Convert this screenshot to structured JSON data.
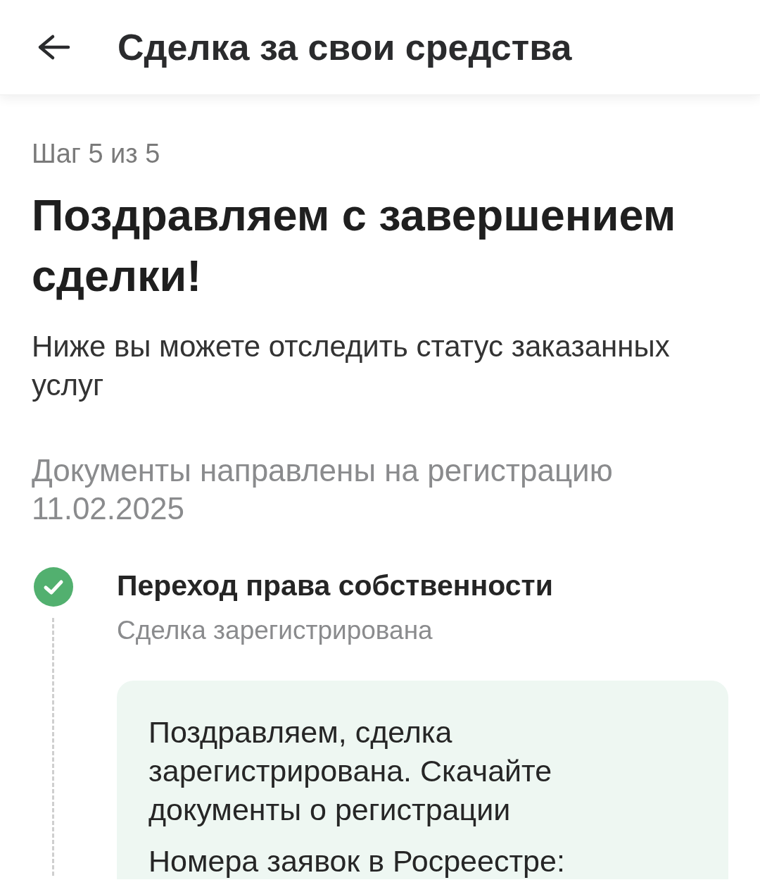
{
  "header": {
    "title": "Сделка за свои средства"
  },
  "step": "Шаг 5 из 5",
  "heading": "Поздравляем с завершением сделки!",
  "intro": "Ниже вы можете отследить статус заказанных услуг",
  "status_note": "Документы направлены на регистрацию 11.02.2025",
  "timeline": [
    {
      "title": "Переход права собственности",
      "subtitle": "Сделка зарегистрирована",
      "done": true,
      "card": {
        "message": "Поздравляем, сделка зарегистрирована. Скачайте документы о регистрации",
        "label": "Номера заявок в Росреестре:"
      }
    }
  ]
}
